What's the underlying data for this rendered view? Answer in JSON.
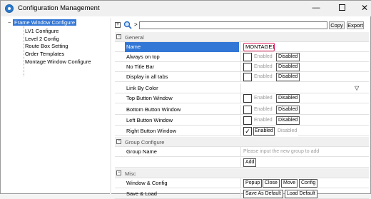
{
  "window": {
    "title": "Configuration Management",
    "min_glyph": "—",
    "close_glyph": "✕"
  },
  "tree": {
    "root": {
      "toggle": "−",
      "label": "Frame Window Configure"
    },
    "items": [
      "LV1 Configure",
      "Level 2 Config",
      "Route Box Setting",
      "Order Templates",
      "Montage Window Configure"
    ]
  },
  "toolbar": {
    "expand_glyph": "+",
    "separator": ">",
    "filter_value": "",
    "copy_label": "Copy",
    "export_label": "Export"
  },
  "grid": {
    "sections": {
      "general": {
        "toggle": "−",
        "label": "General"
      },
      "group_configure": {
        "toggle": "−",
        "label": "Group Configure"
      },
      "misc": {
        "toggle": "−",
        "label": "Misc"
      }
    },
    "name_row": {
      "label": "Name",
      "value": "MONTAGE1"
    },
    "toggle_rows": [
      {
        "label": "Always on top",
        "checked": false,
        "enabled_label": "Enabled",
        "disabled_label": "Disabled"
      },
      {
        "label": "No Title Bar",
        "checked": false,
        "enabled_label": "Enabled",
        "disabled_label": "Disabled"
      },
      {
        "label": "Display in all tabs",
        "checked": false,
        "enabled_label": "Enabled",
        "disabled_label": "Disabled"
      }
    ],
    "link_by_color": {
      "label": "Link By Color",
      "arrow": "▽"
    },
    "button_rows": [
      {
        "label": "Top Button Window",
        "checked": false,
        "enabled_label": "Enabled",
        "disabled_label": "Disabled"
      },
      {
        "label": "Bottom Button Window",
        "checked": false,
        "enabled_label": "Enabled",
        "disabled_label": "Disabled"
      },
      {
        "label": "Left Button Window",
        "checked": false,
        "enabled_label": "Enabled",
        "disabled_label": "Disabled"
      },
      {
        "label": "Right Button Window",
        "checked": true,
        "check_glyph": "✓",
        "enabled_label": "Enabled",
        "disabled_label": "Disabled"
      }
    ],
    "group_name": {
      "label": "Group Name",
      "placeholder": "Please input the new group to add",
      "add_label": "Add"
    },
    "window_config": {
      "label": "Window & Config",
      "buttons": [
        "Popup",
        "Close",
        "Move",
        "Config"
      ]
    },
    "save_load": {
      "label": "Save & Load",
      "buttons": [
        "Save As Default",
        "Load Default"
      ]
    }
  }
}
